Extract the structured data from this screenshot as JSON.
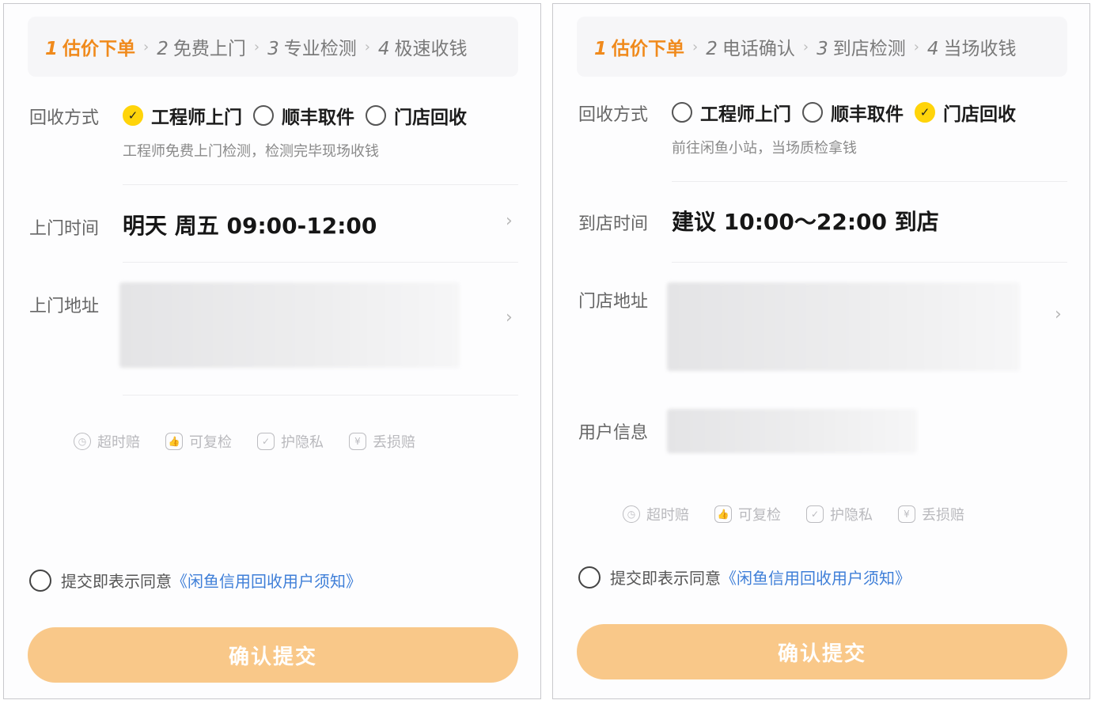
{
  "left": {
    "steps": [
      {
        "num": "1",
        "label": "估价下单",
        "active": true
      },
      {
        "num": "2",
        "label": "免费上门",
        "active": false
      },
      {
        "num": "3",
        "label": "专业检测",
        "active": false
      },
      {
        "num": "4",
        "label": "极速收钱",
        "active": false
      }
    ],
    "method_label": "回收方式",
    "methods": [
      {
        "label": "工程师上门",
        "checked": true
      },
      {
        "label": "顺丰取件",
        "checked": false
      },
      {
        "label": "门店回收",
        "checked": false
      }
    ],
    "method_hint": "工程师免费上门检测，检测完毕现场收钱",
    "time_label": "上门时间",
    "time_value": "明天  周五 09:00-12:00",
    "address_label": "上门地址",
    "guarantees": [
      {
        "icon": "clock-icon",
        "label": "超时赔"
      },
      {
        "icon": "thumbs-up-icon",
        "label": "可复检"
      },
      {
        "icon": "shield-check-icon",
        "label": "护隐私"
      },
      {
        "icon": "yen-icon",
        "label": "丢损赔"
      }
    ],
    "agree_text": "提交即表示同意",
    "agree_link": "《闲鱼信用回收用户须知》",
    "submit_label": "确认提交"
  },
  "right": {
    "steps": [
      {
        "num": "1",
        "label": "估价下单",
        "active": true
      },
      {
        "num": "2",
        "label": "电话确认",
        "active": false
      },
      {
        "num": "3",
        "label": "到店检测",
        "active": false
      },
      {
        "num": "4",
        "label": "当场收钱",
        "active": false
      }
    ],
    "method_label": "回收方式",
    "methods": [
      {
        "label": "工程师上门",
        "checked": false
      },
      {
        "label": "顺丰取件",
        "checked": false
      },
      {
        "label": "门店回收",
        "checked": true
      }
    ],
    "method_hint": "前往闲鱼小站，当场质检拿钱",
    "time_label": "到店时间",
    "time_value": "建议 10:00～22:00 到店",
    "address_label": "门店地址",
    "user_label": "用户信息",
    "guarantees": [
      {
        "icon": "clock-icon",
        "label": "超时赔"
      },
      {
        "icon": "thumbs-up-icon",
        "label": "可复检"
      },
      {
        "icon": "shield-check-icon",
        "label": "护隐私"
      },
      {
        "icon": "yen-icon",
        "label": "丢损赔"
      }
    ],
    "agree_text": "提交即表示同意",
    "agree_link": "《闲鱼信用回收用户须知》",
    "submit_label": "确认提交"
  },
  "colors": {
    "accent": "#f08a1c",
    "radio_checked": "#ffd40a",
    "link": "#3f7fd8",
    "submit": "#f9c889"
  }
}
